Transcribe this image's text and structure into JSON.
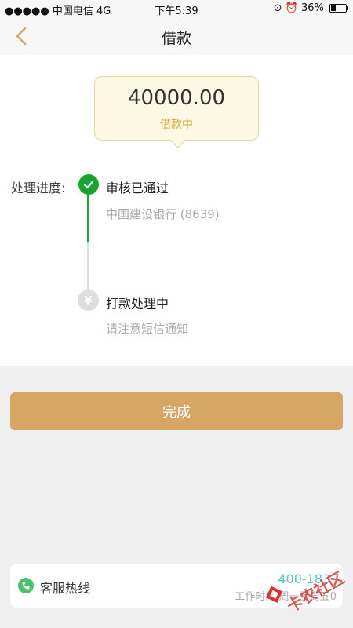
{
  "status_bar": {
    "carrier": "●●●●● 中国电信  4G",
    "time": "下午5:39",
    "battery": "36%"
  },
  "nav": {
    "title": "借款",
    "back_icon": "chevron-left-icon"
  },
  "loan": {
    "amount": "40000.00",
    "status": "借款中"
  },
  "progress": {
    "label": "处理进度:",
    "steps": [
      {
        "title": "审核已通过",
        "subtitle": "中国建设银行 (8639)",
        "state": "done"
      },
      {
        "title": "打款处理中",
        "subtitle": "请注意短信通知",
        "state": "pending"
      }
    ]
  },
  "actions": {
    "done_label": "完成"
  },
  "hotline": {
    "label": "客服热线",
    "number": "400-183-",
    "hours": "工作时间:周一至周五0"
  },
  "watermark": {
    "text": "卡农社区"
  },
  "colors": {
    "accent": "#d6a664",
    "success": "#18a32f",
    "link": "#5bc4c9"
  }
}
